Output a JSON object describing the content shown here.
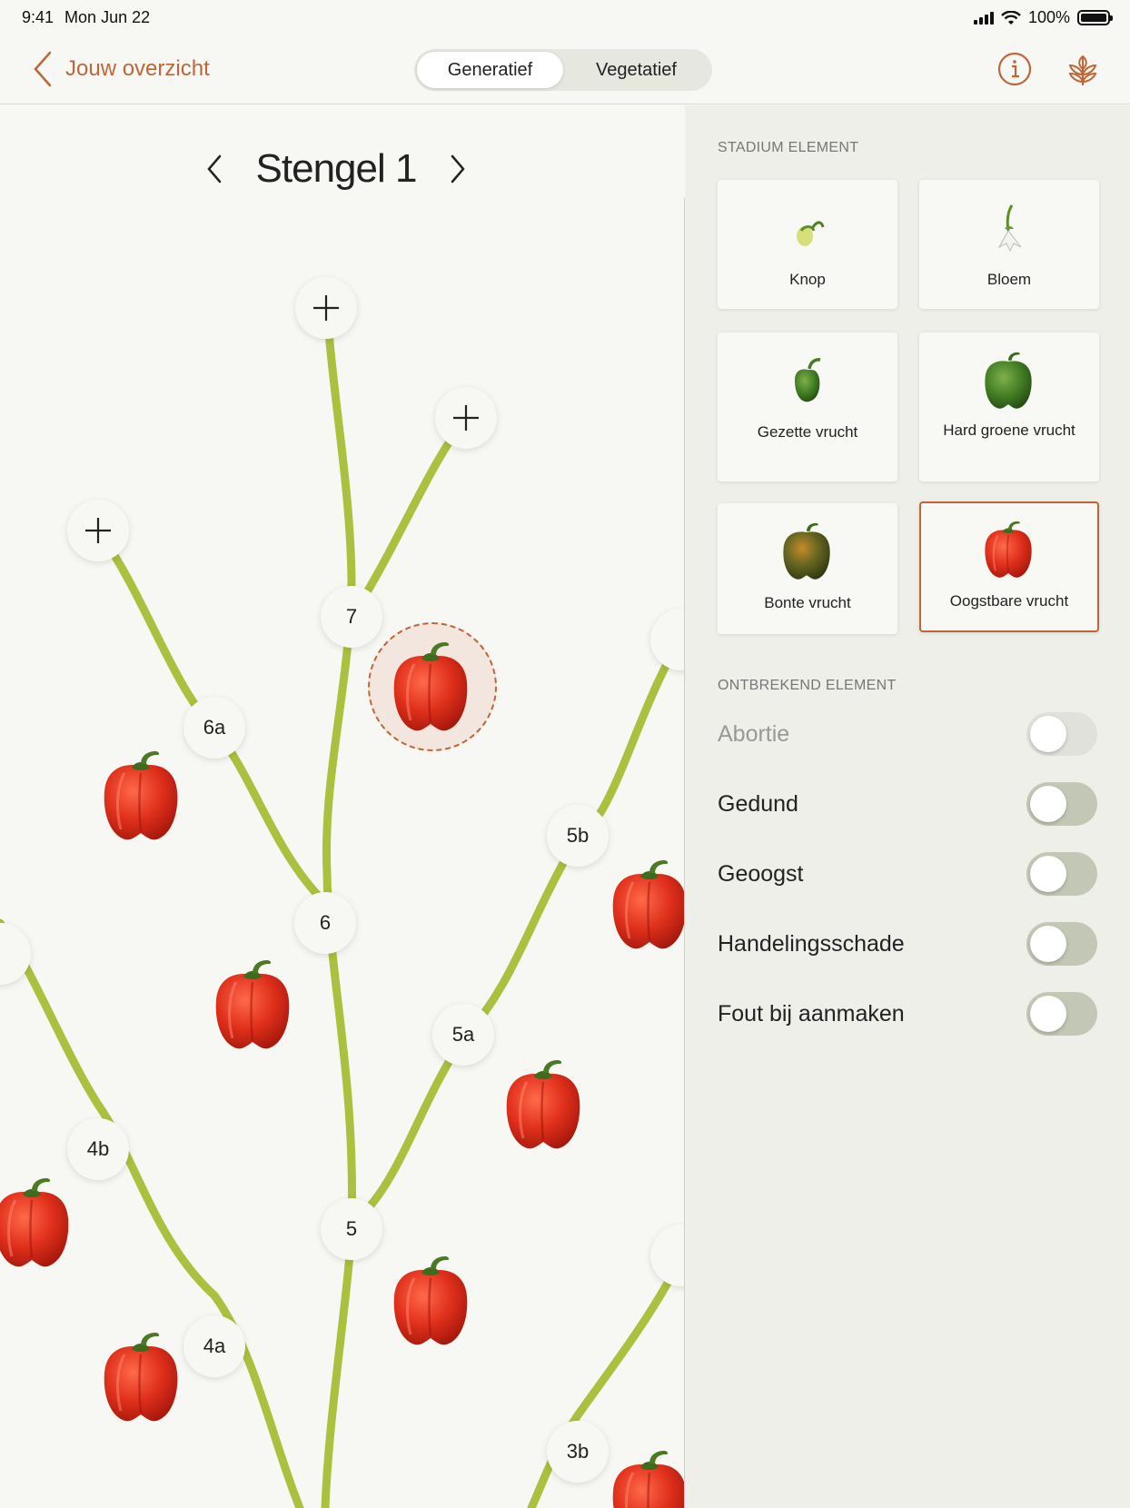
{
  "status_bar": {
    "time": "9:41",
    "date": "Mon Jun 22",
    "battery": "100%"
  },
  "nav": {
    "back_label": "Jouw overzicht",
    "segments": [
      "Generatief",
      "Vegetatief"
    ],
    "active_segment": 0,
    "icons": [
      "info-icon",
      "plant-icon"
    ],
    "accent_color": "#c0653a"
  },
  "stem": {
    "title": "Stengel 1"
  },
  "nodes": [
    "7",
    "6a",
    "6",
    "5b",
    "5a",
    "5",
    "4b",
    "4a",
    "3b"
  ],
  "panel": {
    "stadium_title": "STADIUM ELEMENT",
    "cards": [
      {
        "label": "Knop",
        "icon": "bud-icon"
      },
      {
        "label": "Bloem",
        "icon": "flower-icon"
      },
      {
        "label": "Gezette vrucht",
        "icon": "set-fruit-icon"
      },
      {
        "label": "Hard groene vrucht",
        "icon": "green-pepper-icon"
      },
      {
        "label": "Bonte vrucht",
        "icon": "mottled-pepper-icon"
      },
      {
        "label": "Oogstbare vrucht",
        "icon": "red-pepper-icon",
        "selected": true
      }
    ],
    "missing_title": "ONTBREKEND ELEMENT",
    "toggles": [
      {
        "label": "Abortie",
        "on": false,
        "disabled": true
      },
      {
        "label": "Gedund",
        "on": false,
        "disabled": false
      },
      {
        "label": "Geoogst",
        "on": false,
        "disabled": false
      },
      {
        "label": "Handelingsschade",
        "on": false,
        "disabled": false
      },
      {
        "label": "Fout bij aanmaken",
        "on": false,
        "disabled": false
      }
    ]
  }
}
